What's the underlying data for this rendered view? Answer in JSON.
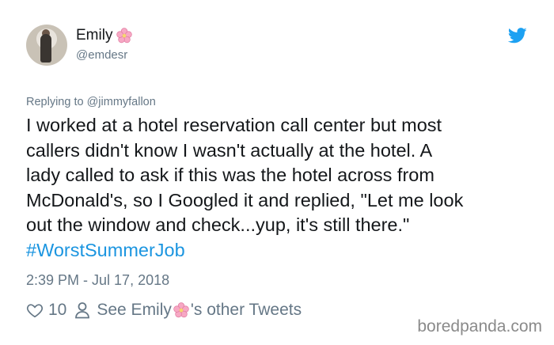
{
  "tweet": {
    "author_name": "Emily",
    "author_handle": "@emdesr",
    "reply_prefix": "Replying to",
    "reply_mention": "@jimmyfallon",
    "body_lines": [
      "I worked at a hotel reservation call center but most",
      "callers didn't know I wasn't actually at the hotel. A",
      "lady called to ask if this was the hotel across from",
      "McDonald's, so I Googled it and replied, \"Let me look",
      "out the window and check...yup, it's still there.\""
    ],
    "hashtag": "#WorstSummerJob",
    "timestamp": "2:39 PM - Jul 17, 2018",
    "like_count": "10",
    "see_tweets_prefix": "See Emily",
    "see_tweets_suffix": "'s other Tweets"
  },
  "watermark": "boredpanda.com",
  "icons": {
    "avatar": "avatar-photo",
    "emoji": "cherry-blossom-icon",
    "brand": "twitter-bird-icon",
    "like": "heart-icon",
    "profile": "person-icon"
  },
  "colors": {
    "text": "#14171a",
    "muted": "#657786",
    "link": "#1b95e0",
    "brand": "#1da1f2",
    "blossom": "#f7a8c4"
  }
}
